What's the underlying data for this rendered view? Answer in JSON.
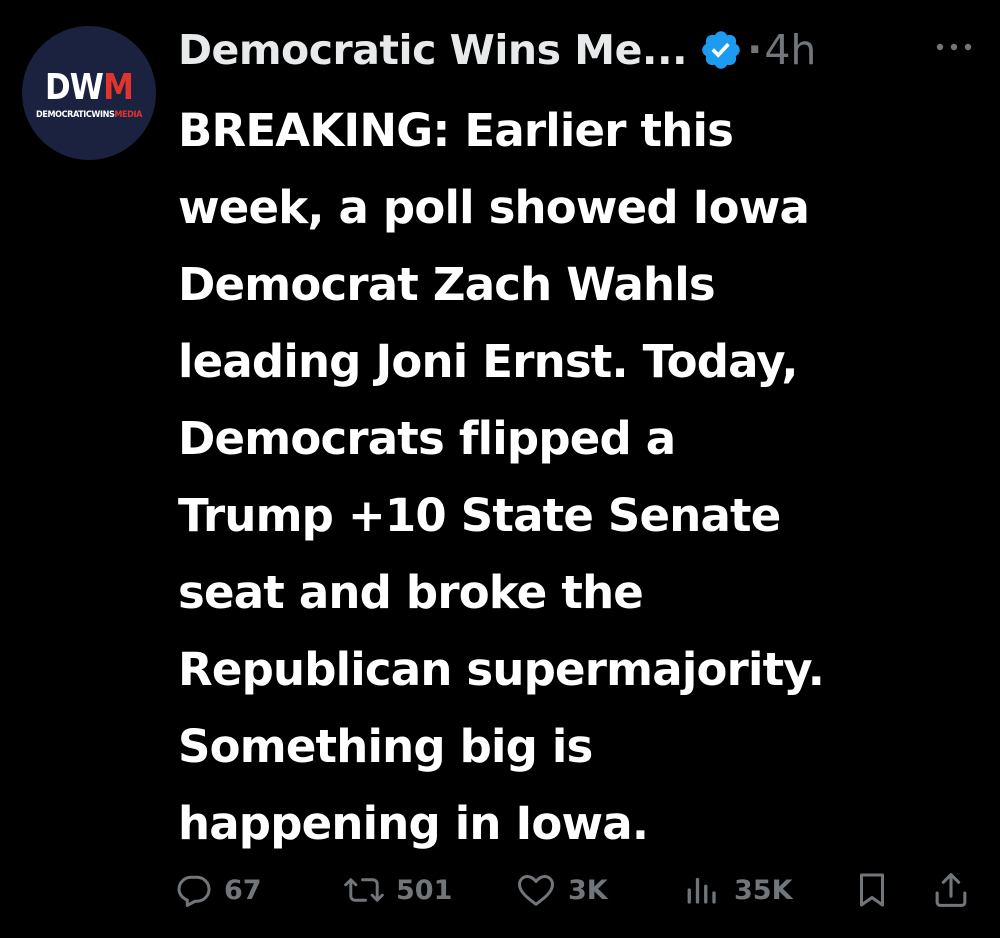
{
  "author": {
    "display_name": "Democratic Wins Me...",
    "timestamp": "4h",
    "separator": "·",
    "verified": true,
    "verified_color": "#1d9bf0",
    "avatar": {
      "monogram_primary": "DW",
      "monogram_accent": "M",
      "wordmark_primary": "DEMOCRATICWINS",
      "wordmark_accent": "MEDIA",
      "background_color": "#1a2240",
      "accent_color": "#e0342c"
    }
  },
  "tweet": {
    "lines": [
      "BREAKING: Earlier this",
      "week, a poll showed Iowa",
      "Democrat Zach Wahls",
      "leading Joni Ernst. Today,",
      "Democrats flipped a",
      "Trump +10 State Senate",
      "seat and broke the",
      "Republican supermajority.",
      "Something big is",
      "happening in Iowa."
    ]
  },
  "actions": {
    "reply_count": "67",
    "repost_count": "501",
    "like_count": "3K",
    "views_count": "35K"
  },
  "icons": {
    "more": "more-icon",
    "reply": "reply-icon",
    "repost": "repost-icon",
    "like": "heart-icon",
    "views": "views-icon",
    "bookmark": "bookmark-icon",
    "share": "share-icon"
  },
  "colors": {
    "background": "#000000",
    "text_primary": "#ffffff",
    "text_secondary": "#71767b"
  }
}
